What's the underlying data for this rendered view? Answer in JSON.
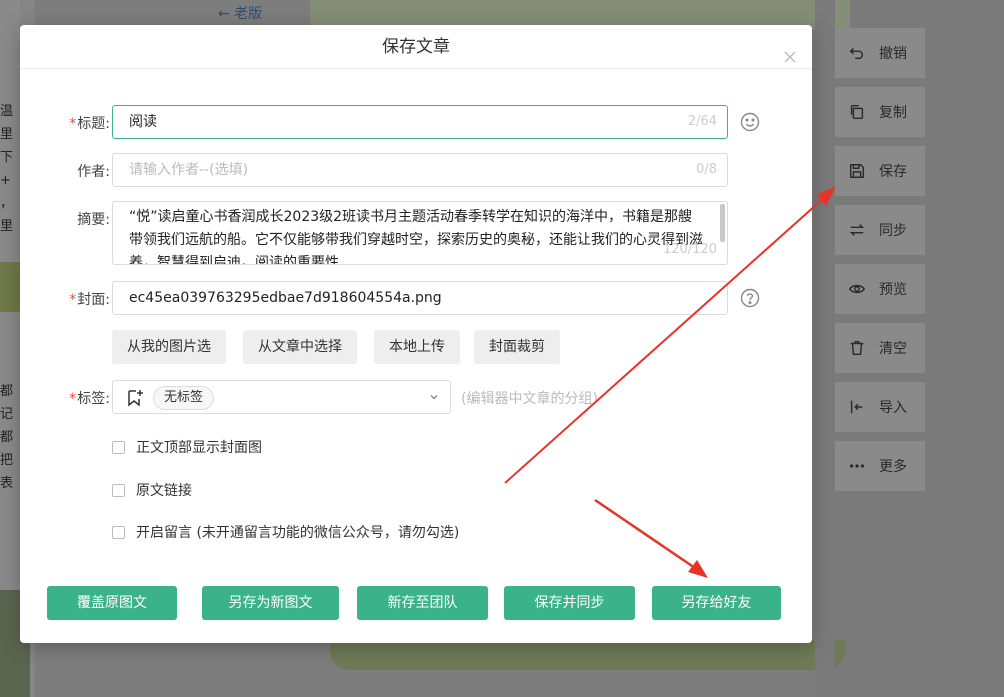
{
  "background": {
    "back_link": "← 老版",
    "left_text_top": [
      "温",
      "里",
      "下",
      "+",
      "，",
      "里"
    ],
    "left_text_bottom": [
      "都",
      "记",
      "都",
      "把",
      "表"
    ]
  },
  "toolbar": {
    "items": [
      {
        "label": "撤销",
        "icon": "undo-icon"
      },
      {
        "label": "复制",
        "icon": "copy-icon"
      },
      {
        "label": "保存",
        "icon": "save-icon"
      },
      {
        "label": "同步",
        "icon": "sync-icon"
      },
      {
        "label": "预览",
        "icon": "eye-icon"
      },
      {
        "label": "清空",
        "icon": "trash-icon"
      },
      {
        "label": "导入",
        "icon": "import-icon"
      },
      {
        "label": "更多",
        "icon": "more-icon"
      }
    ]
  },
  "modal": {
    "title": "保存文章",
    "title_label": "标题:",
    "title_value": "阅读",
    "title_counter": "2/64",
    "author_label": "作者:",
    "author_placeholder": "请输入作者--(选填)",
    "author_counter": "0/8",
    "summary_label": "摘要:",
    "summary_value": "“悦”读启童心书香润成长2023级2班读书月主题活动春季转学在知识的海洋中，书籍是那艘带领我们远航的船。它不仅能够带我们穿越时空，探索历史的奥秘，还能让我们的心灵得到滋养，智慧得到启迪。阅读的重要性",
    "summary_counter": "120/120",
    "cover_label": "封面:",
    "cover_value": "ec45ea039763295edbae7d918604554a.png",
    "cover_buttons": [
      "从我的图片选",
      "从文章中选择",
      "本地上传",
      "封面裁剪"
    ],
    "tags_label": "标签:",
    "tag_chip": "无标签",
    "tags_hint": "(编辑器中文章的分组)",
    "checkboxes": [
      "正文顶部显示封面图",
      "原文链接",
      "开启留言 (未开通留言功能的微信公众号，请勿勾选)"
    ],
    "footer_buttons": [
      "覆盖原图文",
      "另存为新图文",
      "新存至团队",
      "保存并同步",
      "另存给好友"
    ]
  },
  "colors": {
    "accent": "#3bb38a",
    "required": "#e54d42",
    "annotation": "#e5352a"
  }
}
